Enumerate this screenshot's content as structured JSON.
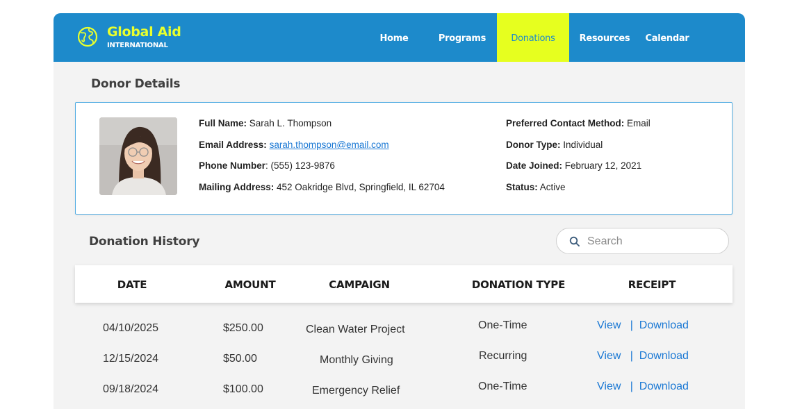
{
  "brand": {
    "name": "Global Aid",
    "tagline": "INTERNATIONAL",
    "title_color": "#e8ff2e",
    "bar_color": "#1d8acb",
    "icon": "globe-icon"
  },
  "nav": {
    "items": [
      {
        "label": "Home"
      },
      {
        "label": "Programs"
      },
      {
        "label": "Donations",
        "active": true
      },
      {
        "label": "Resources"
      },
      {
        "label": "Calendar"
      }
    ],
    "active_color": "#e6ff1f"
  },
  "donor_details": {
    "title": "Donor Details",
    "photo": "donor-photo",
    "fields": {
      "full_name": {
        "label": "Full Name:",
        "value": "Sarah L. Thompson"
      },
      "email": {
        "label": "Email Address:",
        "value": "sarah.thompson@email.com"
      },
      "phone": {
        "label": "Phone Number",
        "value": ": (555) 123-9876"
      },
      "mailing": {
        "label": "Mailing Address:",
        "value": "452 Oakridge Blvd, Springfield, IL 62704"
      },
      "contact_method": {
        "label": "Preferred Contact Method:",
        "value": "Email"
      },
      "donor_type": {
        "label": "Donor Type:",
        "value": "Individual"
      },
      "date_joined": {
        "label": "Date Joined:",
        "value": "February 12, 2021"
      },
      "status": {
        "label": "Status:",
        "value": "Active"
      }
    }
  },
  "donation_history": {
    "title": "Donation History",
    "search": {
      "placeholder": "Search",
      "icon": "search-icon"
    },
    "columns": [
      "DATE",
      "AMOUNT",
      "CAMPAIGN",
      "DONATION TYPE",
      "RECEIPT"
    ],
    "rows": [
      {
        "date": "04/10/2025",
        "amount": "$250.00",
        "campaign": "Clean Water Project",
        "type": "One-Time",
        "view": "View",
        "sep": "|",
        "download": "Download"
      },
      {
        "date": "12/15/2024",
        "amount": "$50.00",
        "campaign": "Monthly Giving",
        "type": "Recurring",
        "view": "View",
        "sep": "|",
        "download": "Download"
      },
      {
        "date": "09/18/2024",
        "amount": "$100.00",
        "campaign": "Emergency Relief",
        "type": "One-Time",
        "view": "View",
        "sep": "|",
        "download": "Download"
      }
    ]
  }
}
